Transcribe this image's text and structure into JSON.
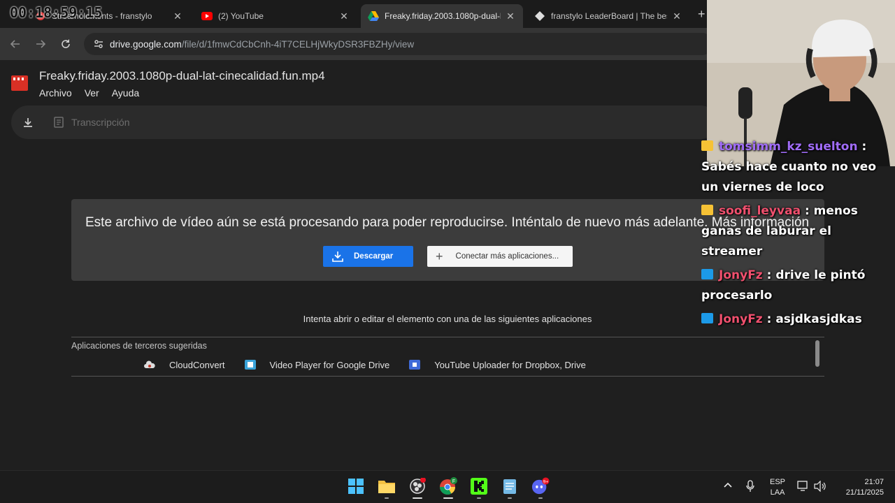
{
  "browser": {
    "tabs": [
      {
        "title": "Streamelements - franstylo",
        "active": false
      },
      {
        "title": "(2) YouTube",
        "active": false
      },
      {
        "title": "Freaky.friday.2003.1080p-dual-l",
        "active": true
      },
      {
        "title": "franstylo LeaderBoard | The bes",
        "active": false
      }
    ],
    "close_glyph": "✕",
    "new_tab_glyph": "+",
    "url_host": "drive.google.com",
    "url_path": "/file/d/1fmwCdCbCnh-4iT7CELHjWkyDSR3FBZHy/view"
  },
  "stream_timer": "00:18:59:15",
  "drive": {
    "file_name": "Freaky.friday.2003.1080p-dual-lat-cinecalidad.fun.mp4",
    "menu": [
      "Archivo",
      "Ver",
      "Ayuda"
    ],
    "transcript_label": "Transcripción"
  },
  "dialog": {
    "message": "Este archivo de vídeo aún se está procesando para poder reproducirse. Inténtalo de nuevo más adelante. Más información",
    "download_label": "Descargar",
    "connect_label": "Conectar más aplicaciones..."
  },
  "apps_section": {
    "try_text": "Intenta abrir o editar el elemento con una de las siguientes aplicaciones",
    "suggested_label": "Aplicaciones de terceros sugeridas",
    "apps": [
      "CloudConvert",
      "Video Player for Google Drive",
      "YouTube Uploader for Dropbox, Drive"
    ]
  },
  "chat": [
    {
      "user": "tomsimm_kz_suelton",
      "text": " : Sabés hace cuanto no veo un viernes de loco",
      "badge": "crown",
      "user_color": "#a06cf7"
    },
    {
      "user": "soofi_leyvaa",
      "text": " : menos ganas de laburar el streamer",
      "badge": "crown",
      "user_color": "#f0506e"
    },
    {
      "user": "JonyFz",
      "text": " : drive le pintó procesarlo",
      "badge": "prime",
      "user_color": "#f0506e"
    },
    {
      "user": "JonyFz",
      "text": " : asjdkasjdkas",
      "badge": "prime",
      "user_color": "#f0506e"
    }
  ],
  "taskbar": {
    "discord_badge": "9+",
    "chrome_badge": "F",
    "lang_top": "ESP",
    "lang_bottom": "LAA",
    "time": "21:07",
    "date": "21/11/2025"
  },
  "colors": {
    "accent_blue": "#1a73e8",
    "dialog_bg": "#3c3c3c",
    "page_bg": "#1f1f1f",
    "chat_user_red": "#f0506e"
  }
}
